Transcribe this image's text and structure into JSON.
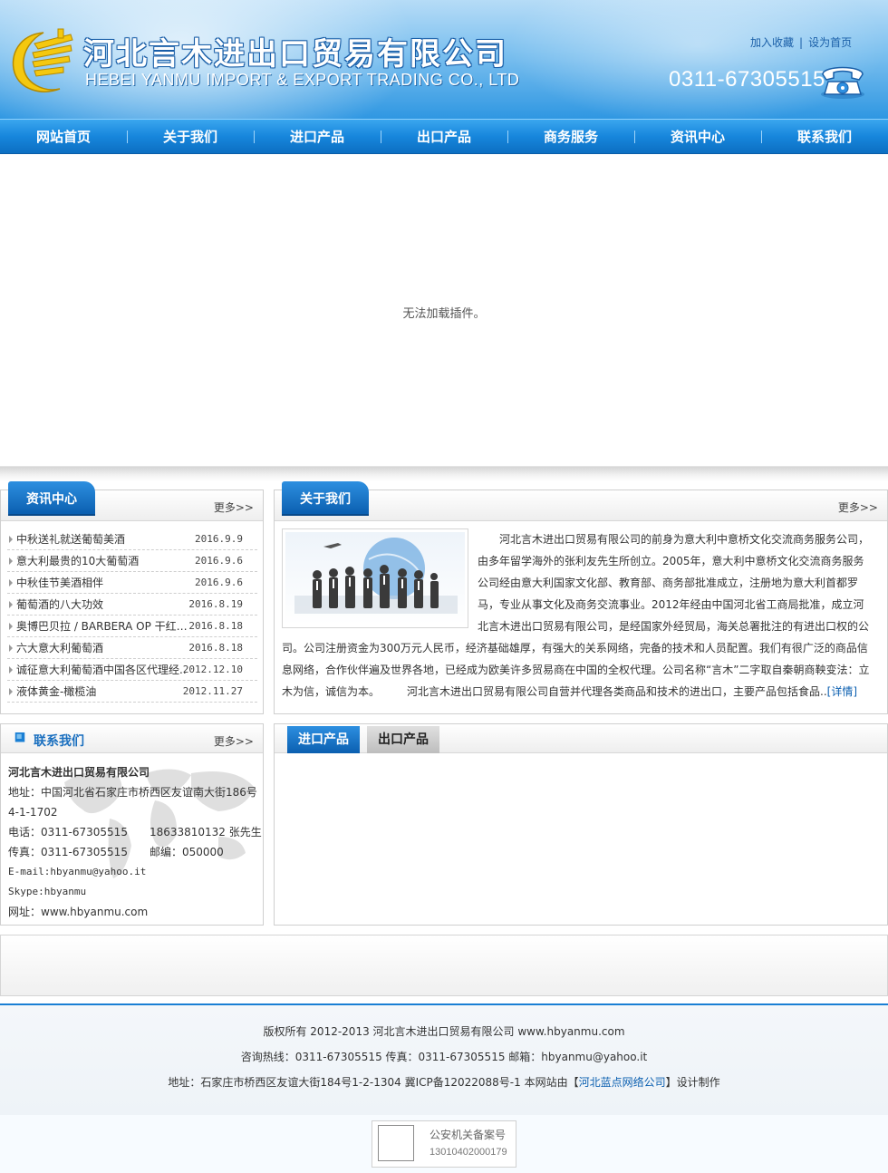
{
  "header": {
    "company_cn": "河北言木进出口贸易有限公司",
    "company_en": "HEBEI YANMU IMPORT & EXPORT TRADING CO., LTD",
    "links": [
      "加入收藏",
      "设为首页"
    ],
    "phone": "0311-67305515"
  },
  "nav": {
    "items": [
      "网站首页",
      "关于我们",
      "进口产品",
      "出口产品",
      "商务服务",
      "资讯中心",
      "联系我们"
    ]
  },
  "banner": {
    "plugin_message": "无法加载插件。"
  },
  "news": {
    "title": "资讯中心",
    "more": "更多>>",
    "items": [
      {
        "title": "中秋送礼就送葡萄美酒",
        "date": "2016.9.9"
      },
      {
        "title": "意大利最贵的10大葡萄酒",
        "date": "2016.9.6"
      },
      {
        "title": "中秋佳节美酒相伴",
        "date": "2016.9.6"
      },
      {
        "title": "葡萄酒的八大功效",
        "date": "2016.8.19"
      },
      {
        "title": "奥博巴贝拉 / BARBERA OP 干红葡..",
        "date": "2016.8.18"
      },
      {
        "title": "六大意大利葡萄酒",
        "date": "2016.8.18"
      },
      {
        "title": "诚征意大利葡萄酒中国各区代理经..",
        "date": "2012.12.10"
      },
      {
        "title": "液体黄金-橄榄油",
        "date": "2012.11.27"
      }
    ]
  },
  "about": {
    "title": "关于我们",
    "more": "更多>>",
    "text": "　　河北言木进出口贸易有限公司的前身为意大利中意桥文化交流商务服务公司，由多年留学海外的张利友先生所创立。2005年，意大利中意桥文化交流商务服务公司经由意大利国家文化部、教育部、商务部批准成立，注册地为意大利首都罗马，专业从事文化及商务交流事业。2012年经由中国河北省工商局批准，成立河北言木进出口贸易有限公司，是经国家外经贸局，海关总署批注的有进出口权的公司。公司注册资金为300万元人民币，经济基础雄厚，有强大的关系网络，完备的技术和人员配置。我们有很广泛的商品信息网络，合作伙伴遍及世界各地，已经成为欧美许多贸易商在中国的全权代理。公司名称“言木”二字取自秦朝商鞅变法：立木为信，诚信为本。　　　河北言木进出口贸易有限公司自营并代理各类商品和技术的进出口，主要产品包括食品..",
    "detail_label": "[详情]"
  },
  "contact": {
    "title": "联系我们",
    "more": "更多>>",
    "company": "河北言木进出口贸易有限公司",
    "address": "地址：中国河北省石家庄市桥西区友谊南大街186号4-1-1702",
    "tel": "电话：0311-67305515　　18633810132 张先生",
    "fax": "传真：0311-67305515　　邮编：050000",
    "email": "E-mail:hbyanmu@yahoo.it",
    "skype": "Skype:hbyanmu",
    "website": "网址：www.hbyanmu.com"
  },
  "products": {
    "tabs": [
      "进口产品",
      "出口产品"
    ],
    "active": 0
  },
  "footer": {
    "line1": "版权所有 2012-2013 河北言木进出口贸易有限公司 www.hbyanmu.com",
    "line2": "咨询热线：0311-67305515 传真：0311-67305515 邮箱：hbyanmu@yahoo.it",
    "line3_prefix": "地址：石家庄市桥西区友谊大街184号1-2-1304 冀ICP备12022088号-1 本网站由【",
    "line3_link": "河北蓝点网络公司",
    "line3_suffix": "】设计制作",
    "police_title": "公安机关备案号",
    "police_number": "13010402000179"
  },
  "colors": {
    "brand_blue": "#1786dc",
    "dark_blue": "#0b5fb0",
    "link_blue": "#0b5fb0"
  }
}
